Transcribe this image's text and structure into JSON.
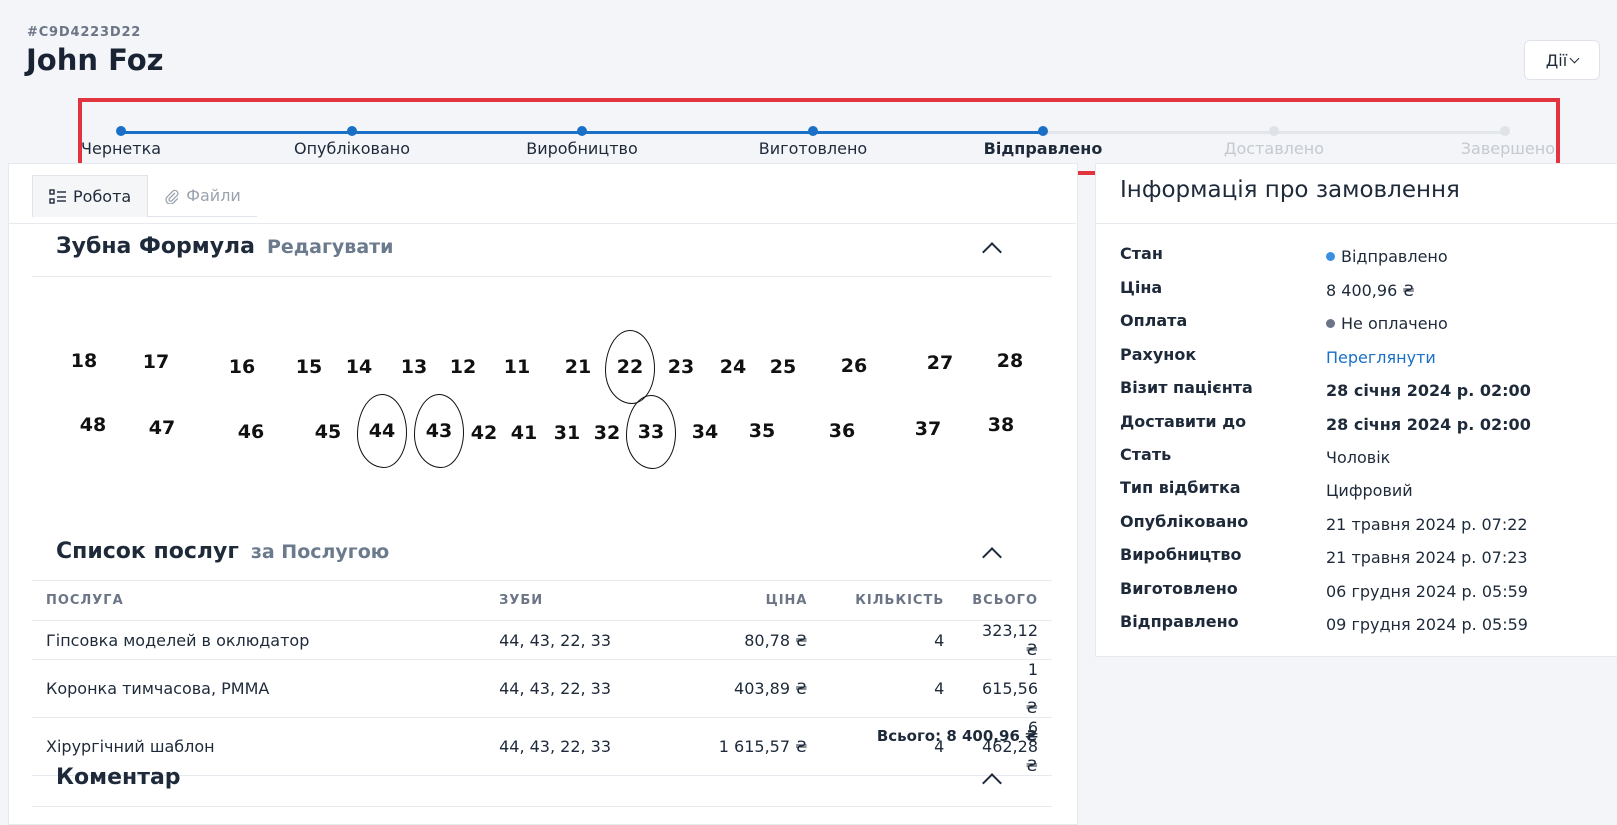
{
  "header": {
    "order_id": "#C9D4223D22",
    "title": "John Foz",
    "actions_label": "Дії"
  },
  "stepper": {
    "steps": [
      {
        "label": "Чернетка",
        "state": "done"
      },
      {
        "label": "Опубліковано",
        "state": "done"
      },
      {
        "label": "Виробництво",
        "state": "done"
      },
      {
        "label": "Виготовлено",
        "state": "done"
      },
      {
        "label": "Відправлено",
        "state": "current"
      },
      {
        "label": "Доставлено",
        "state": "todo"
      },
      {
        "label": "Завершено",
        "state": "todo"
      }
    ]
  },
  "tabs": [
    {
      "label": "Робота",
      "active": true
    },
    {
      "label": "Файли",
      "active": false
    }
  ],
  "tooth_formula": {
    "title": "Зубна Формула",
    "edit_label": "Редагувати",
    "upper": [
      "18",
      "17",
      "16",
      "15",
      "14",
      "13",
      "12",
      "11",
      "21",
      "22",
      "23",
      "24",
      "25",
      "26",
      "27",
      "28"
    ],
    "lower": [
      "48",
      "47",
      "46",
      "45",
      "44",
      "43",
      "42",
      "41",
      "31",
      "32",
      "33",
      "34",
      "35",
      "36",
      "37",
      "38"
    ],
    "selected": [
      "22",
      "44",
      "43",
      "33"
    ]
  },
  "services": {
    "title": "Список послуг",
    "group_label": "за Послугою",
    "columns": [
      "ПОСЛУГА",
      "ЗУБИ",
      "ЦІНА",
      "КІЛЬКІСТЬ",
      "ВСЬОГО"
    ],
    "rows": [
      {
        "name": "Гіпсовка моделей в оклюдатор",
        "teeth": "44, 43, 22, 33",
        "price": "80,78 ₴",
        "qty": "4",
        "total": "323,12 ₴"
      },
      {
        "name": "Коронка тимчасова, PMMA",
        "teeth": "44, 43, 22, 33",
        "price": "403,89 ₴",
        "qty": "4",
        "total": "1 615,56 ₴"
      },
      {
        "name": "Хірургічний шаблон",
        "teeth": "44, 43, 22, 33",
        "price": "1 615,57 ₴",
        "qty": "4",
        "total": "6 462,28 ₴"
      }
    ],
    "grand_total": "Всього: 8 400,96 ₴"
  },
  "comment": {
    "title": "Коментар"
  },
  "order_info": {
    "title": "Інформація про замовлення",
    "status_color_shipped": "#3b8fe0",
    "status_color_unpaid": "#6b7585",
    "rows": [
      {
        "key": "Стан",
        "value": "Відправлено"
      },
      {
        "key": "Ціна",
        "value": "8 400,96 ₴"
      },
      {
        "key": "Оплата",
        "value": "Не оплачено"
      },
      {
        "key": "Рахунок",
        "value": "Переглянути"
      },
      {
        "key": "Візит пацієнта",
        "value": "28 січня 2024 р. 02:00"
      },
      {
        "key": "Доставити до",
        "value": "28 січня 2024 р. 02:00"
      },
      {
        "key": "Стать",
        "value": "Чоловік"
      },
      {
        "key": "Тип відбитка",
        "value": "Цифровий"
      },
      {
        "key": "Опубліковано",
        "value": "21 травня 2024 р. 07:22"
      },
      {
        "key": "Виробництво",
        "value": "21 травня 2024 р. 07:23"
      },
      {
        "key": "Виготовлено",
        "value": "06 грудня 2024 р. 05:59"
      },
      {
        "key": "Відправлено",
        "value": "09 грудня 2024 р. 05:59"
      }
    ]
  }
}
